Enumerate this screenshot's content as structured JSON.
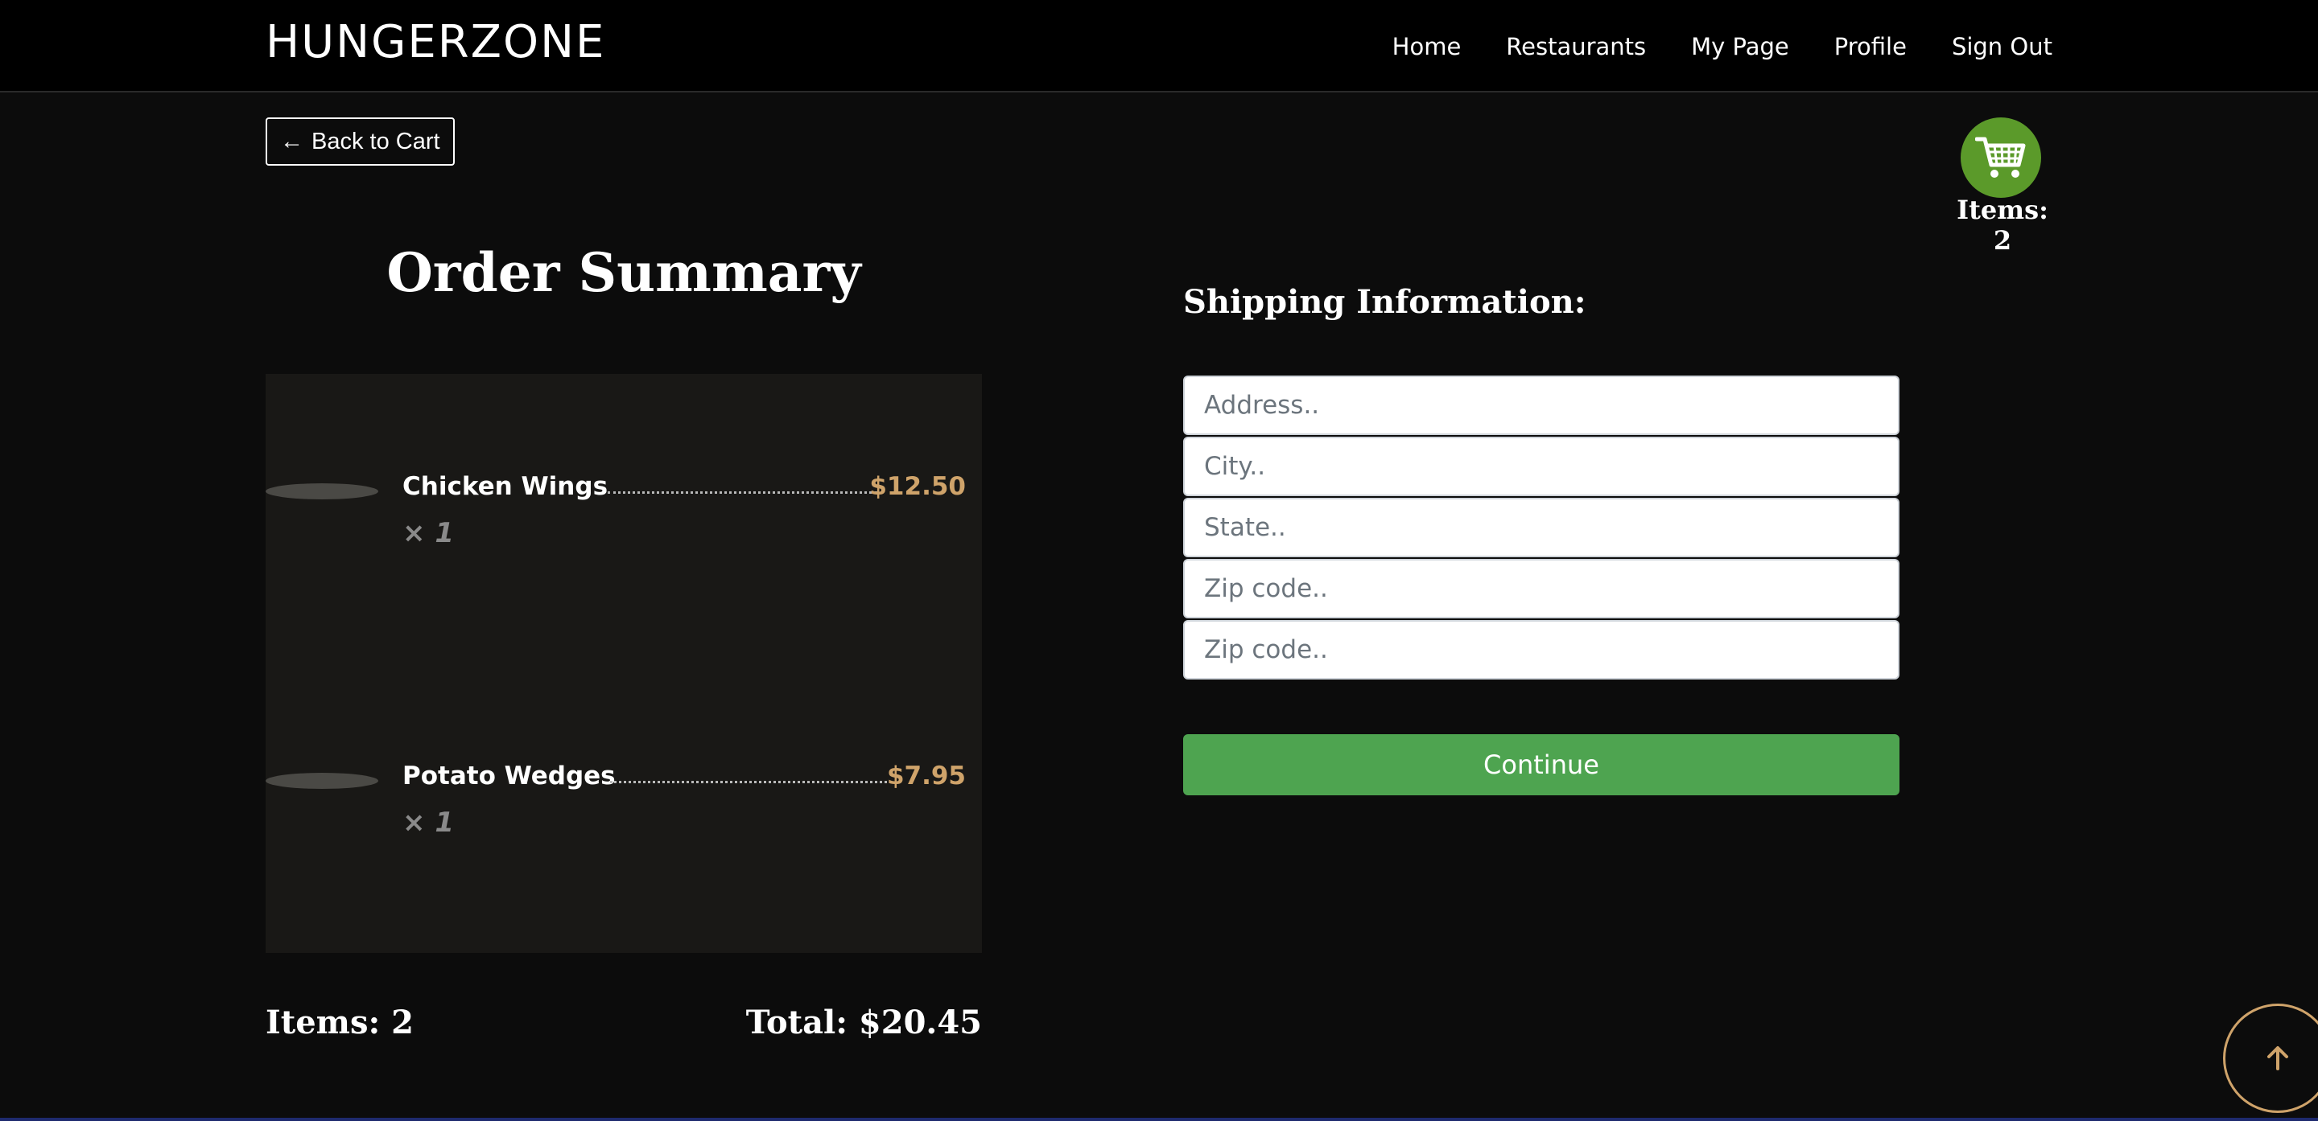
{
  "header": {
    "brand": "HUNGERZONE",
    "nav": [
      {
        "label": "Home"
      },
      {
        "label": "Restaurants"
      },
      {
        "label": "My Page"
      },
      {
        "label": "Profile"
      },
      {
        "label": "Sign Out"
      }
    ]
  },
  "back_button": {
    "arrow": "←",
    "label": "Back to Cart"
  },
  "cart": {
    "icon": "shopping-cart-icon",
    "count_label": "Items: 2"
  },
  "order_summary": {
    "title": "Order Summary",
    "items": [
      {
        "name": "Chicken Wings",
        "price": "$12.50",
        "qty_symbol": "×",
        "qty": "1"
      },
      {
        "name": "Potato Wedges",
        "price": "$7.95",
        "qty_symbol": "×",
        "qty": "1"
      }
    ],
    "items_label": "Items: 2",
    "total_label": "Total: $20.45"
  },
  "shipping": {
    "title": "Shipping Information:",
    "fields": [
      {
        "placeholder": "Address.."
      },
      {
        "placeholder": "City.."
      },
      {
        "placeholder": "State.."
      },
      {
        "placeholder": "Zip code.."
      },
      {
        "placeholder": "Zip code.."
      }
    ],
    "continue_label": "Continue"
  },
  "colors": {
    "accent_green": "#4ea450",
    "cart_green": "#5b9a2a",
    "price_gold": "#cfa36a"
  }
}
